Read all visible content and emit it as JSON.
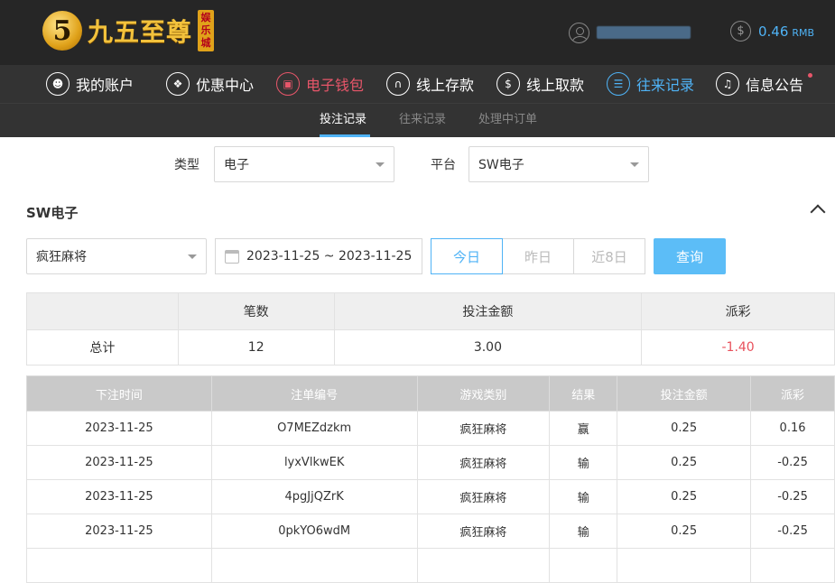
{
  "header": {
    "logo_digit": "5",
    "logo_text": "九五至尊",
    "logo_badge": [
      "娱",
      "乐",
      "城"
    ],
    "balance_amount": "0.46",
    "balance_unit": "RMB"
  },
  "nav": [
    {
      "label": "我的账户",
      "icon": "user-icon"
    },
    {
      "label": "优惠中心",
      "icon": "gift-icon"
    },
    {
      "label": "电子钱包",
      "icon": "wallet-icon"
    },
    {
      "label": "线上存款",
      "icon": "deposit-icon"
    },
    {
      "label": "线上取款",
      "icon": "withdraw-icon"
    },
    {
      "label": "往来记录",
      "icon": "records-icon"
    },
    {
      "label": "信息公告",
      "icon": "bell-icon"
    }
  ],
  "subnav": [
    "投注记录",
    "往来记录",
    "处理中订单"
  ],
  "filters": {
    "type_label": "类型",
    "type_value": "电子",
    "platform_label": "平台",
    "platform_value": "SW电子"
  },
  "section_title": "SW电子",
  "game_select": "疯狂麻将",
  "date_range": "2023-11-25 ~ 2023-11-25",
  "quick_dates": [
    "今日",
    "昨日",
    "近8日"
  ],
  "query_label": "查询",
  "summary": {
    "headers": [
      "",
      "笔数",
      "投注金额",
      "派彩"
    ],
    "row": [
      "总计",
      "12",
      "3.00",
      "-1.40"
    ]
  },
  "records": {
    "headers": [
      "下注时间",
      "注单编号",
      "游戏类别",
      "结果",
      "投注金额",
      "派彩"
    ],
    "rows": [
      [
        "2023-11-25",
        "O7MEZdzkm",
        "疯狂麻将",
        "赢",
        "0.25",
        "0.16"
      ],
      [
        "2023-11-25",
        "lyxVlkwEK",
        "疯狂麻将",
        "输",
        "0.25",
        "-0.25"
      ],
      [
        "2023-11-25",
        "4pgJjQZrK",
        "疯狂麻将",
        "输",
        "0.25",
        "-0.25"
      ],
      [
        "2023-11-25",
        "0pkYO6wdM",
        "疯狂麻将",
        "输",
        "0.25",
        "-0.25"
      ]
    ]
  },
  "colors": {
    "accent_blue": "#4fb3f6",
    "accent_red": "#e8566a",
    "negative": "#e8505b"
  }
}
